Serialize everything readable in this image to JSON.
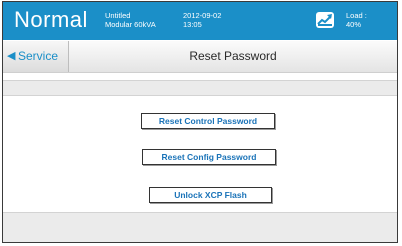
{
  "status": {
    "mode": "Normal",
    "device_name": "Untitled",
    "device_model": "Modular 60kVA",
    "date": "2012-09-02",
    "time": "13:05",
    "load_label": "Load :",
    "load_value": "40%",
    "load_icon": "load-gauge-icon"
  },
  "nav": {
    "back_label": "Service",
    "back_icon": "triangle-left-icon",
    "title": "Reset Password"
  },
  "actions": {
    "reset_control": "Reset Control Password",
    "reset_config": "Reset Config Password",
    "unlock_xcp": "Unlock XCP Flash"
  },
  "colors": {
    "header_blue": "#1b8fc8",
    "button_text_blue": "#1a73b8",
    "band_gray": "#ebebeb"
  }
}
